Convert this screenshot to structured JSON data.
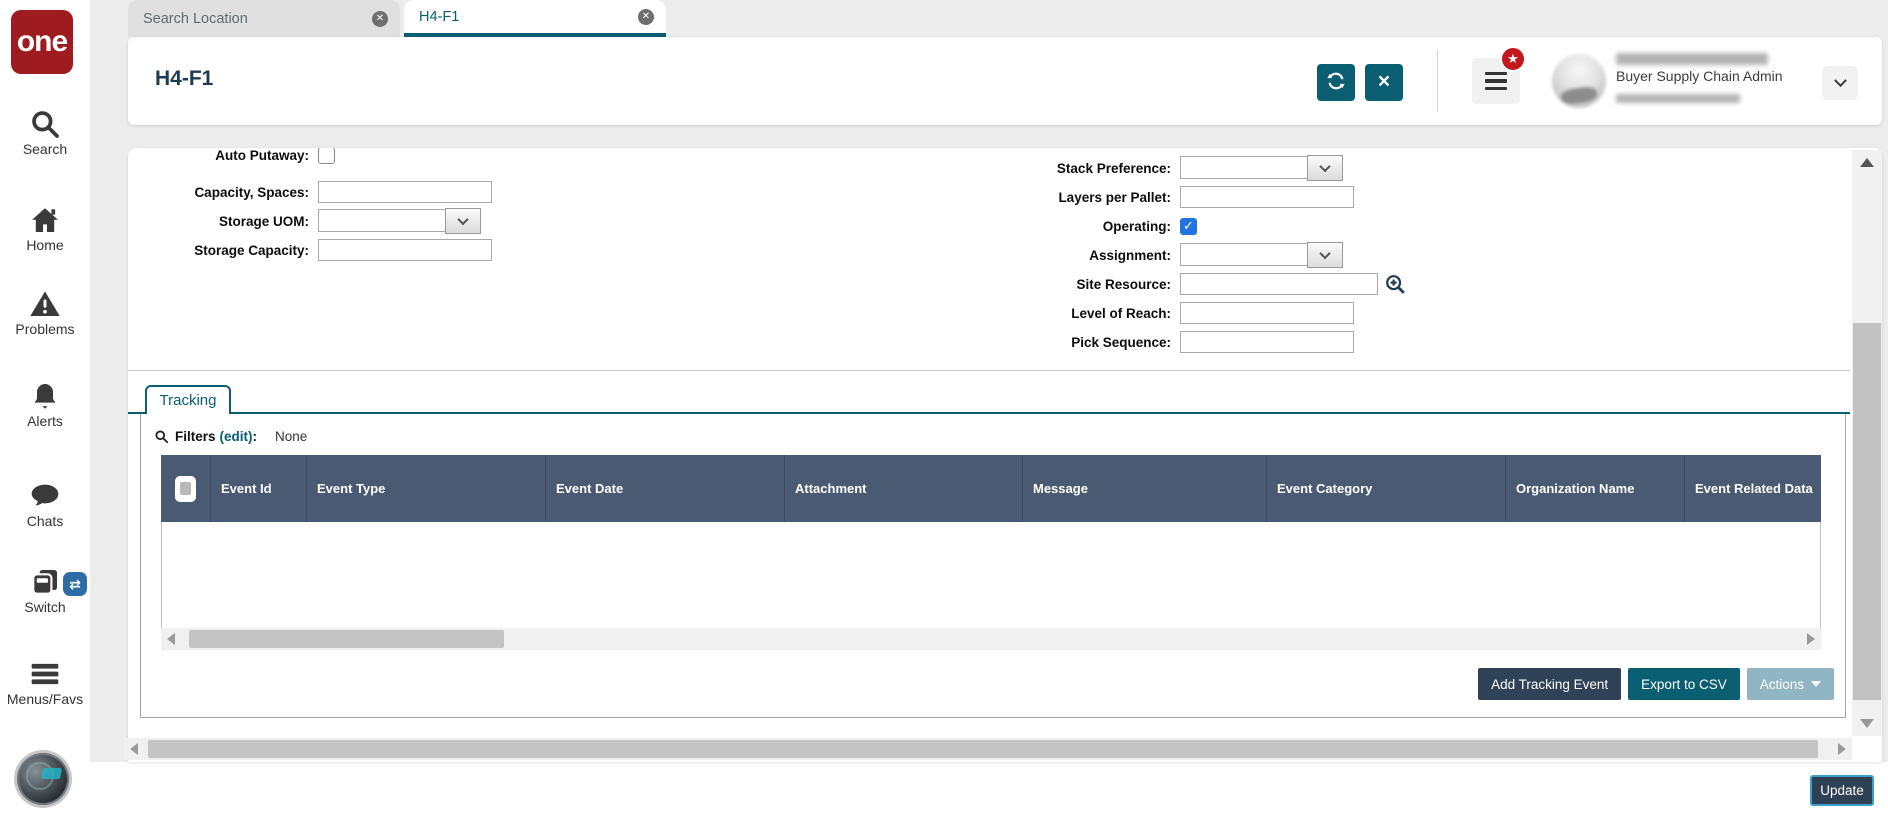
{
  "sidebar": {
    "logo_text": "one",
    "items": [
      {
        "id": "search",
        "label": "Search",
        "icon": "search"
      },
      {
        "id": "home",
        "label": "Home",
        "icon": "home"
      },
      {
        "id": "problems",
        "label": "Problems",
        "icon": "warning-triangle"
      },
      {
        "id": "alerts",
        "label": "Alerts",
        "icon": "bell"
      },
      {
        "id": "chats",
        "label": "Chats",
        "icon": "chat-bubble"
      },
      {
        "id": "switch",
        "label": "Switch",
        "icon": "pages",
        "badge_icon": "swap-arrows"
      },
      {
        "id": "menus-favs",
        "label": "Menus/Favs",
        "icon": "hamburger"
      }
    ]
  },
  "tabs": [
    {
      "label": "Search Location",
      "active": false,
      "close_icon": "circle-x"
    },
    {
      "label": "H4-F1",
      "active": true,
      "close_icon": "circle-x"
    }
  ],
  "header": {
    "title": "H4-F1",
    "actions": [
      {
        "id": "refresh",
        "icon": "refresh-icon"
      },
      {
        "id": "close",
        "icon": "close-icon"
      }
    ],
    "menu_icon": "hamburger-icon",
    "menu_badge_icon": "star-icon",
    "user": {
      "role": "Buyer Supply Chain Admin",
      "name_redacted": true,
      "org_redacted": true,
      "dropdown_icon": "chevron-down-icon"
    }
  },
  "form": {
    "left": [
      {
        "label": "Auto Putaway:",
        "type": "checkbox",
        "checked": false
      },
      {
        "label": "Capacity, Spaces:",
        "type": "text",
        "value": ""
      },
      {
        "label": "Storage UOM:",
        "type": "select",
        "value": ""
      },
      {
        "label": "Storage Capacity:",
        "type": "text",
        "value": ""
      }
    ],
    "right": [
      {
        "label": "Stack Preference:",
        "type": "select",
        "value": ""
      },
      {
        "label": "Layers per Pallet:",
        "type": "text",
        "value": ""
      },
      {
        "label": "Operating:",
        "type": "checkbox",
        "checked": true
      },
      {
        "label": "Assignment:",
        "type": "select",
        "value": ""
      },
      {
        "label": "Site Resource:",
        "type": "lookup",
        "value": "",
        "icon": "magnifier-plus-icon"
      },
      {
        "label": "Level of Reach:",
        "type": "text",
        "value": ""
      },
      {
        "label": "Pick Sequence:",
        "type": "text",
        "value": ""
      }
    ]
  },
  "tracking": {
    "tab_label": "Tracking",
    "filters_icon": "magnifier-icon",
    "filters_label": "Filters",
    "filters_edit": "(edit)",
    "filters_suffix": ":",
    "filters_value": "None",
    "columns": [
      "Event Id",
      "Event Type",
      "Event Date",
      "Attachment",
      "Message",
      "Event Category",
      "Organization Name",
      "Event Related Data"
    ],
    "rows": [],
    "buttons": [
      {
        "id": "add",
        "label": "Add Tracking Event"
      },
      {
        "id": "export",
        "label": "Export to CSV"
      },
      {
        "id": "actions",
        "label": "Actions",
        "has_dropdown": true
      }
    ]
  },
  "footer": {
    "update_label": "Update"
  },
  "colors": {
    "teal": "#0a5e72",
    "navy": "#2f4257",
    "slate": "#4a5a73",
    "logo-red": "#9e1c20",
    "badge-red": "#c1181d",
    "muted-btn": "#8fb6c2",
    "check-blue": "#2273e0",
    "update-navy": "#2e4053",
    "update-border": "#3da0c8",
    "switch-badge": "#2d6ca5"
  }
}
